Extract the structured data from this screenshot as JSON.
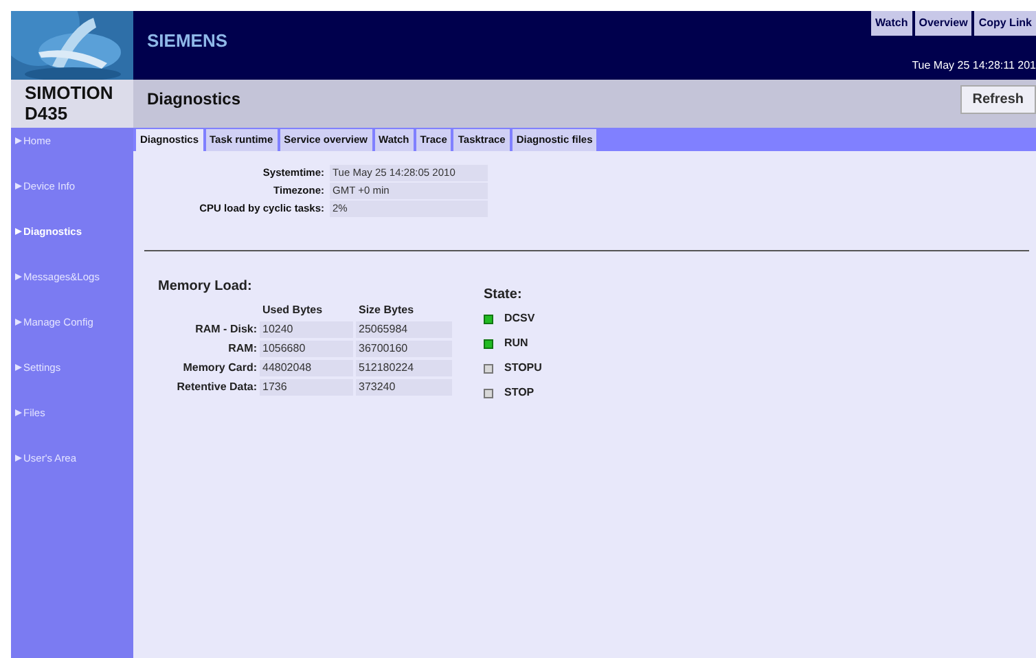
{
  "header": {
    "brand": "SIEMENS",
    "links": [
      {
        "label": "Watch"
      },
      {
        "label": "Overview"
      },
      {
        "label": "Copy Link"
      }
    ],
    "datetime": "Tue May 25 14:28:11 201"
  },
  "device": {
    "name": "SIMOTION",
    "model": "D435"
  },
  "page_title": "Diagnostics",
  "refresh_button": "Refresh",
  "sidebar": {
    "items": [
      {
        "label": "Home",
        "selected": false
      },
      {
        "label": "Device Info",
        "selected": false
      },
      {
        "label": "Diagnostics",
        "selected": true
      },
      {
        "label": "Messages&Logs",
        "selected": false
      },
      {
        "label": "Manage Config",
        "selected": false
      },
      {
        "label": "Settings",
        "selected": false
      },
      {
        "label": "Files",
        "selected": false
      },
      {
        "label": "User's Area",
        "selected": false
      }
    ]
  },
  "tabs": [
    {
      "label": "Diagnostics",
      "selected": true
    },
    {
      "label": "Task runtime",
      "selected": false
    },
    {
      "label": "Service overview",
      "selected": false
    },
    {
      "label": "Watch",
      "selected": false
    },
    {
      "label": "Trace",
      "selected": false
    },
    {
      "label": "Tasktrace",
      "selected": false
    },
    {
      "label": "Diagnostic files",
      "selected": false
    }
  ],
  "info": [
    {
      "label": "Systemtime:",
      "value": "Tue May 25 14:28:05 2010"
    },
    {
      "label": "Timezone:",
      "value": "GMT +0 min"
    },
    {
      "label": "CPU load by cyclic tasks:",
      "value": "2%"
    }
  ],
  "memory": {
    "title": "Memory Load:",
    "columns": [
      "Used Bytes",
      "Size Bytes"
    ],
    "rows": [
      {
        "label": "RAM - Disk:",
        "used": "10240",
        "size": "25065984"
      },
      {
        "label": "RAM:",
        "used": "1056680",
        "size": "36700160"
      },
      {
        "label": "Memory Card:",
        "used": "44802048",
        "size": "512180224"
      },
      {
        "label": "Retentive Data:",
        "used": "1736",
        "size": "373240"
      }
    ]
  },
  "state": {
    "title": "State:",
    "items": [
      {
        "label": "DCSV",
        "on": true
      },
      {
        "label": "RUN",
        "on": true
      },
      {
        "label": "STOPU",
        "on": false
      },
      {
        "label": "STOP",
        "on": false
      }
    ]
  }
}
